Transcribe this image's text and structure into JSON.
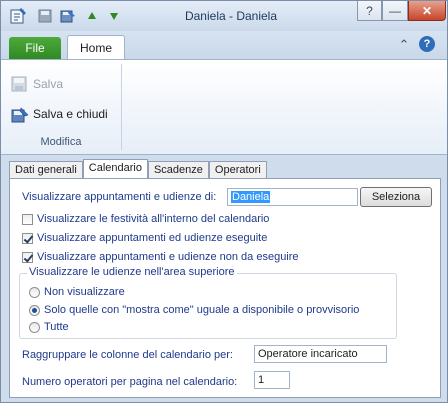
{
  "window": {
    "title": "Daniela - Daniela"
  },
  "titlebar": {
    "icons": [
      "app-icon",
      "save-icon",
      "save-close-icon",
      "up-arrow-icon",
      "down-arrow-icon"
    ],
    "buttons": {
      "help": "?",
      "minimize": "—",
      "restore": "❐",
      "close": "✕"
    }
  },
  "ribbon": {
    "tabs": {
      "file": "File",
      "home": "Home"
    },
    "collapse_glyph": "⌃",
    "help_glyph": "?",
    "buttons": {
      "save": "Salva",
      "save_close": "Salva e chiudi"
    },
    "group_label": "Modifica"
  },
  "content_tabs": [
    "Dati generali",
    "Calendario",
    "Scadenze",
    "Operatori"
  ],
  "active_tab": "Calendario",
  "calendar": {
    "show_label": "Visualizzare appuntamenti  e udienze di:",
    "show_value": "Daniela",
    "select_button": "Seleziona",
    "checkboxes": [
      {
        "label": "Visualizzare le festività all'interno del calendario",
        "checked": false
      },
      {
        "label": "Visualizzare appuntamenti ed udienze eseguite",
        "checked": true
      },
      {
        "label": "Visualizzare appuntamenti e udienze non da eseguire",
        "checked": true
      }
    ],
    "upper_area_title": "Visualizzare le udienze nell'area superiore",
    "radios": [
      {
        "label": "Non visualizzare",
        "selected": false
      },
      {
        "label": "Solo quelle con \"mostra come\" uguale a disponibile o provvisorio",
        "selected": true
      },
      {
        "label": "Tutte",
        "selected": false
      }
    ],
    "group_columns_label": "Raggruppare le colonne del calendario per:",
    "group_columns_value": "Operatore incaricato",
    "operators_per_page_label": "Numero operatori per pagina nel calendario:",
    "operators_per_page_value": "1"
  }
}
